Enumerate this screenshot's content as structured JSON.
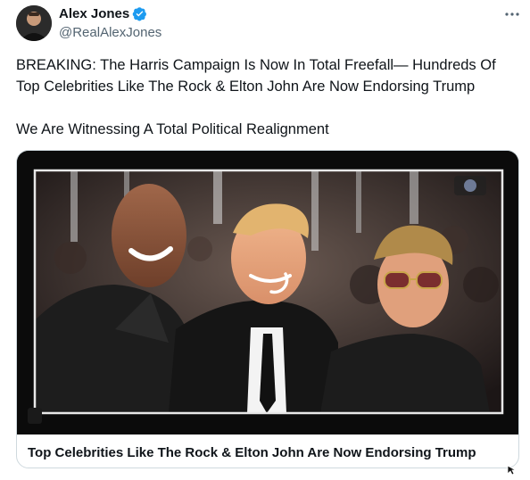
{
  "author": {
    "display_name": "Alex Jones",
    "handle": "@RealAlexJones",
    "verified_icon": "verified-badge-icon",
    "avatar_icon": "avatar"
  },
  "more_icon": "more-options-icon",
  "tweet": {
    "text": "BREAKING: The Harris Campaign Is Now In Total Freefall— Hundreds Of Top Celebrities Like The Rock & Elton John Are Now Endorsing Trump\n\nWe Are Witnessing A Total Political Realignment"
  },
  "card": {
    "title": "Top Celebrities Like The Rock & Elton John Are Now Endorsing Trump",
    "image_icon": "card-image"
  },
  "colors": {
    "text_primary": "#0f1419",
    "text_secondary": "#536471",
    "verified_blue": "#1d9bf0",
    "border": "#cfd9de"
  }
}
